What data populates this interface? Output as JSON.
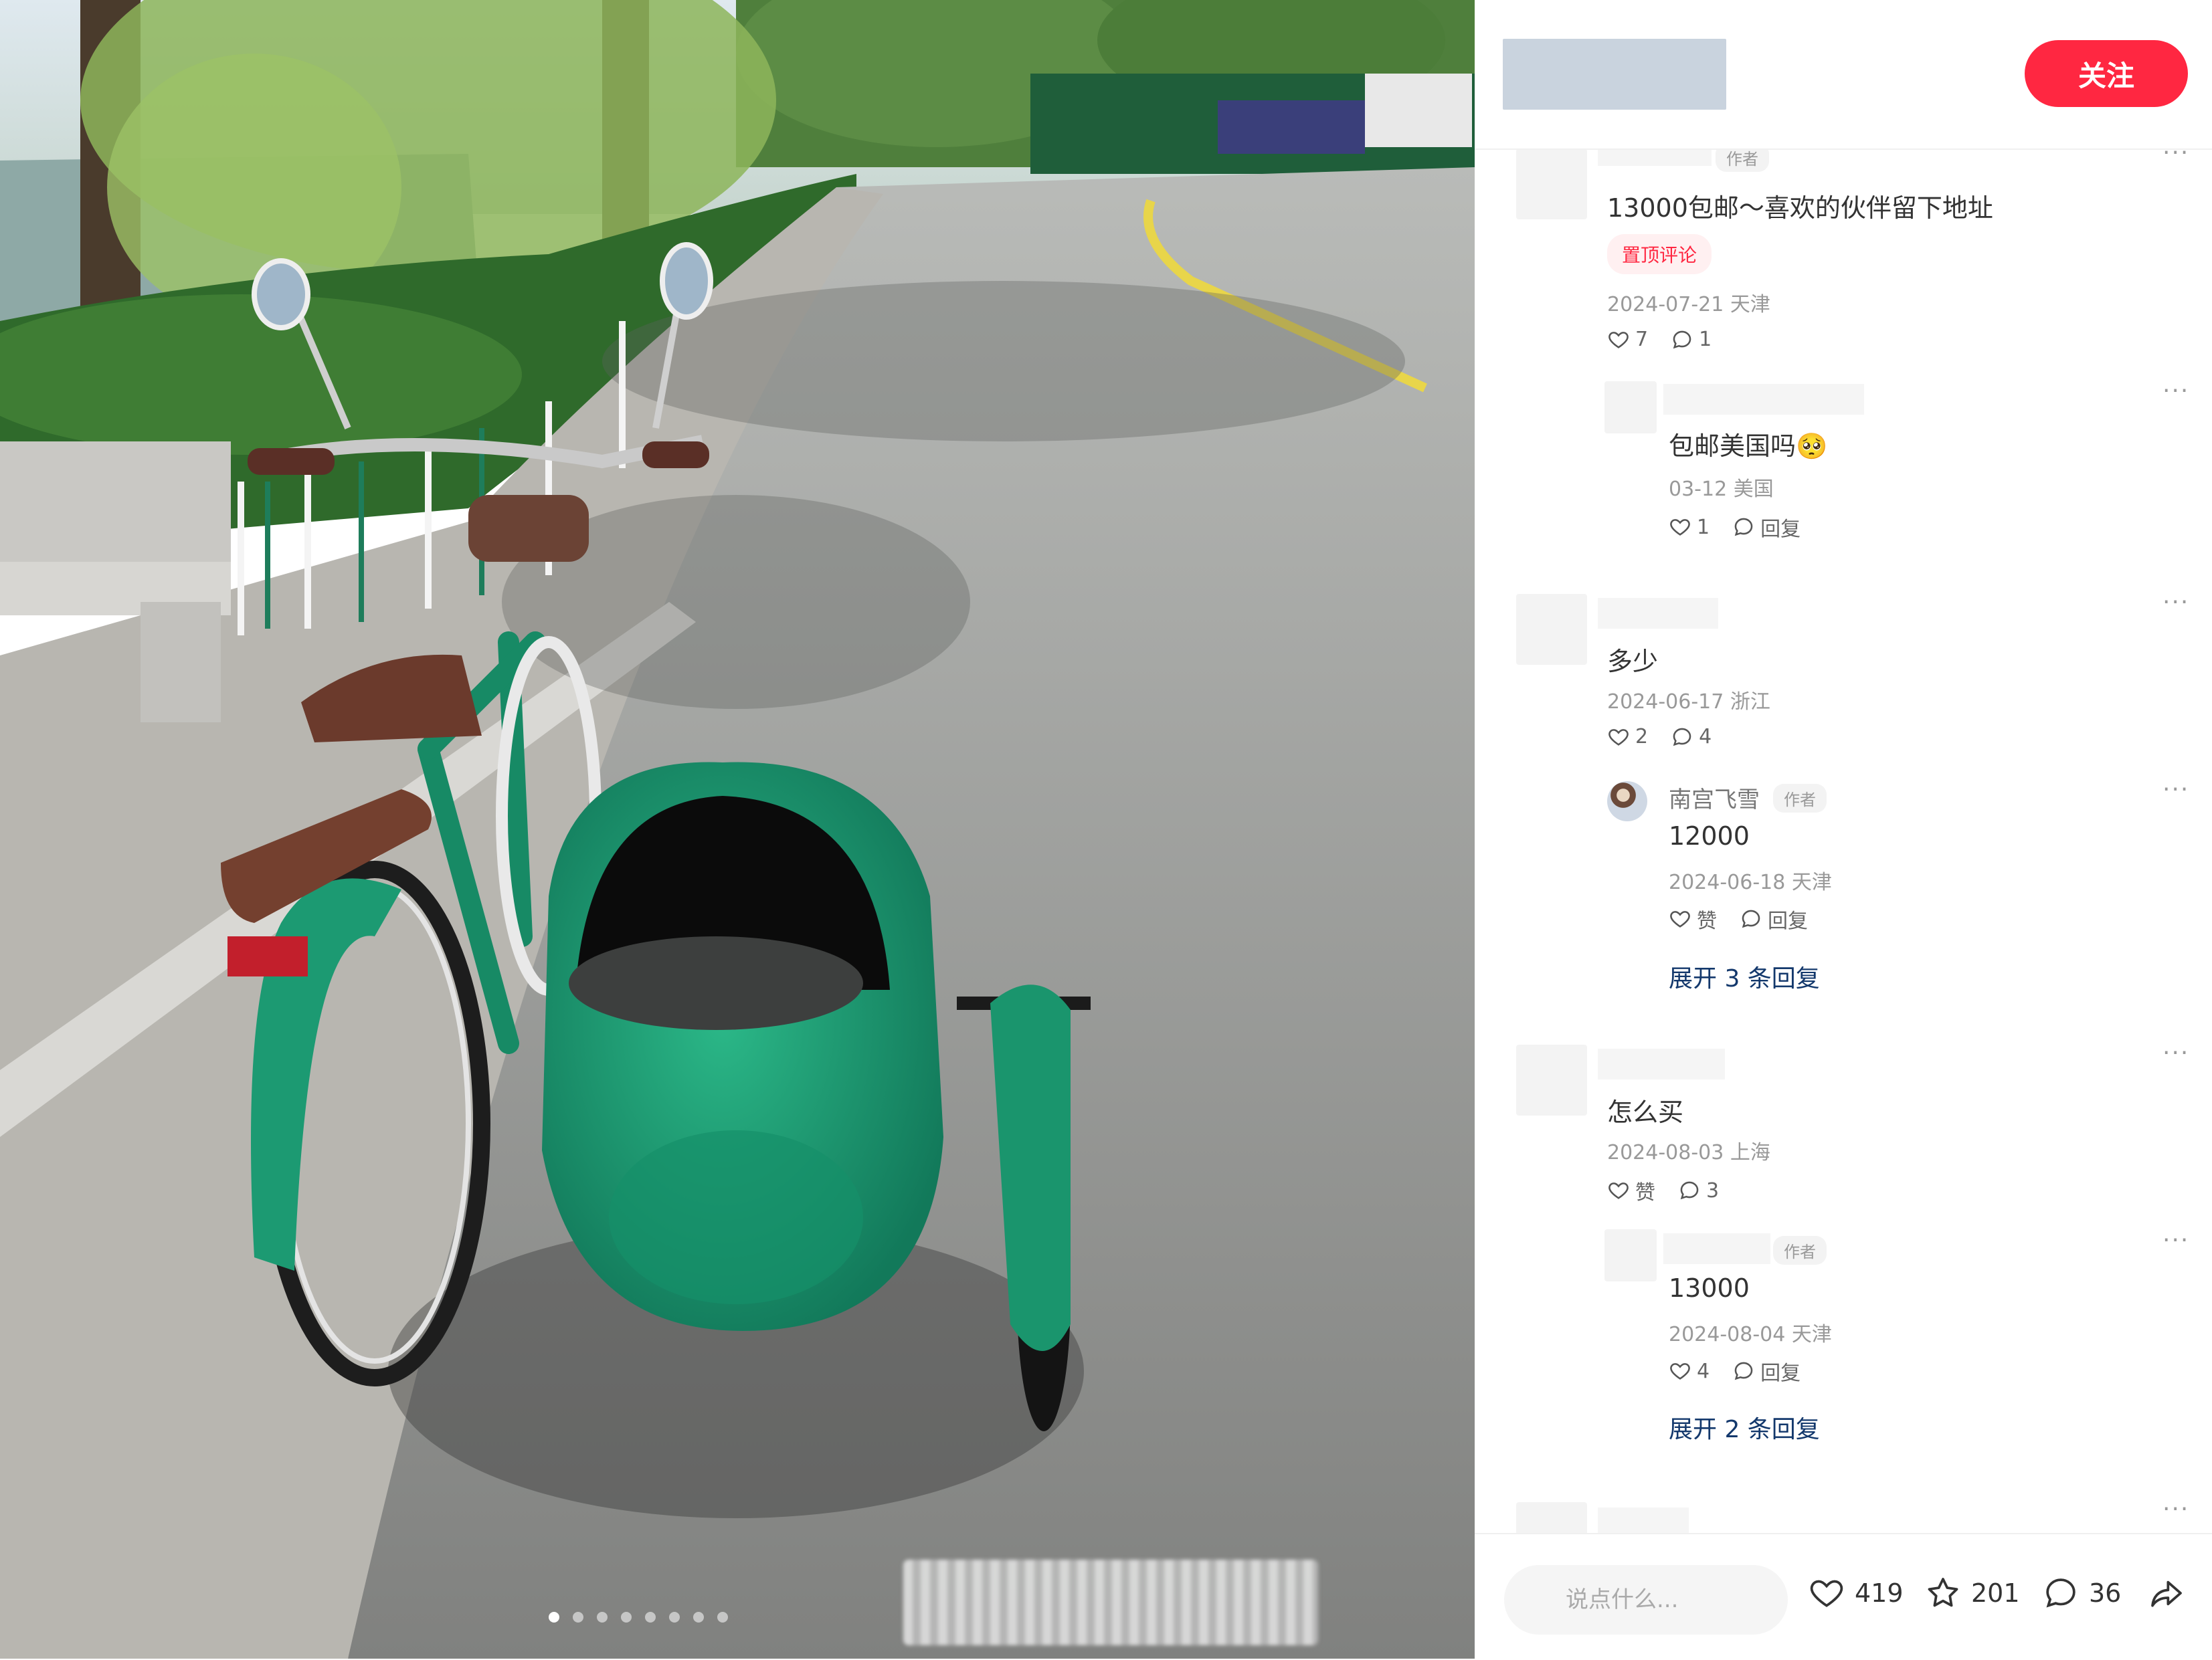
{
  "header": {
    "follow_label": "关注"
  },
  "comments": [
    {
      "is_author": true,
      "author_tag": "作者",
      "text": "13000包邮～喜欢的伙伴留下地址",
      "pin_label": "置顶评论",
      "date_location": "2024-07-21 天津",
      "likes": "7",
      "replies": "1",
      "sub": [
        {
          "text": "包邮美国吗🥺",
          "date_location": "03-12 美国",
          "likes": "1",
          "reply_label": "回复"
        }
      ]
    },
    {
      "text": "多少",
      "date_location": "2024-06-17 浙江",
      "likes": "2",
      "replies": "4",
      "sub": [
        {
          "name": "南宫飞雪",
          "author_tag": "作者",
          "text": "12000",
          "date_location": "2024-06-18 天津",
          "like_label": "赞",
          "reply_label": "回复"
        }
      ],
      "expand_label": "展开 3 条回复"
    },
    {
      "text": "怎么买",
      "date_location": "2024-08-03 上海",
      "like_label": "赞",
      "replies": "3",
      "sub": [
        {
          "author_tag": "作者",
          "text": "13000",
          "date_location": "2024-08-04 天津",
          "likes": "4",
          "reply_label": "回复"
        }
      ],
      "expand_label": "展开 2 条回复"
    }
  ],
  "more_label": "···",
  "footer": {
    "input_placeholder": "说点什么...",
    "likes": "419",
    "collects": "201",
    "comments": "36"
  },
  "colors": {
    "accent": "#ff2741",
    "link": "#13386c",
    "sidecar": "#1f9a72",
    "road": "#8f8f8c"
  },
  "carousel": {
    "total": 8,
    "active": 1
  }
}
